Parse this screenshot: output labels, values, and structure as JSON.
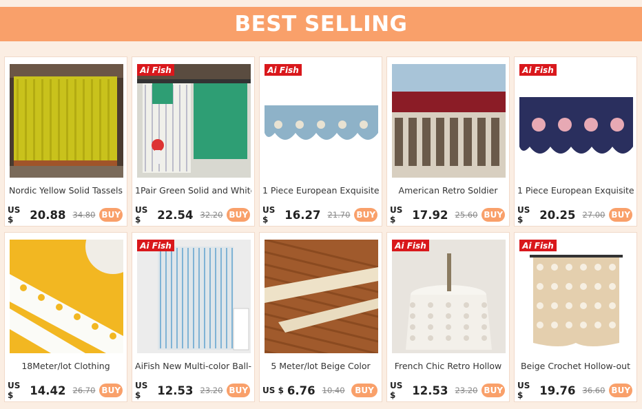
{
  "banner": {
    "title": "BEST SELLING"
  },
  "currency_label": "US $",
  "buy_label": "BUY",
  "brand_logo_text": "Ai Fish",
  "colors": {
    "banner": "#f9a06a",
    "buy_button": "#f9a06a",
    "logo": "#d9181c"
  },
  "products": [
    {
      "name": "Nordic Yellow Solid Tassels",
      "price": "20.88",
      "old_price": "34.80",
      "has_logo": false,
      "image": "yellow-curtain"
    },
    {
      "name": "1Pair Green Solid and White",
      "price": "22.54",
      "old_price": "32.20",
      "has_logo": true,
      "image": "green-curtain"
    },
    {
      "name": "1 Piece European Exquisite",
      "price": "16.27",
      "old_price": "21.70",
      "has_logo": true,
      "image": "blue-valance"
    },
    {
      "name": "American Retro Soldier",
      "price": "17.92",
      "old_price": "25.60",
      "has_logo": false,
      "image": "retro-curtain"
    },
    {
      "name": "1 Piece European Exquisite",
      "price": "20.25",
      "old_price": "27.00",
      "has_logo": true,
      "image": "navy-valance"
    },
    {
      "name": "18Meter/lot Clothing",
      "price": "14.42",
      "old_price": "26.70",
      "has_logo": false,
      "image": "lace-trim"
    },
    {
      "name": "AiFish New Multi-color Ball-",
      "price": "12.53",
      "old_price": "23.20",
      "has_logo": true,
      "image": "string-curtain"
    },
    {
      "name": "5 Meter/lot Beige Color",
      "price": "6.76",
      "old_price": "10.40",
      "has_logo": false,
      "image": "crochet-trim"
    },
    {
      "name": "French Chic Retro Hollow",
      "price": "12.53",
      "old_price": "23.20",
      "has_logo": true,
      "image": "lace-tablecloth"
    },
    {
      "name": "Beige Crochet Hollow-out",
      "price": "19.76",
      "old_price": "36.60",
      "has_logo": true,
      "image": "crochet-curtain"
    }
  ]
}
